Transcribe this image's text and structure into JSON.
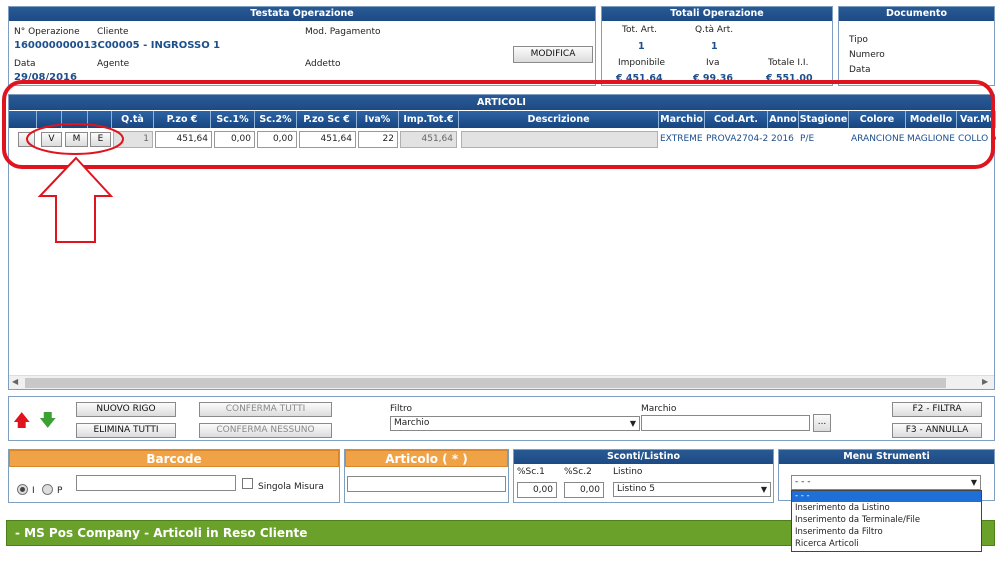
{
  "testata": {
    "title": "Testata Operazione",
    "n_operazione_label": "N° Operazione",
    "cliente_label": "Cliente",
    "mod_pagamento_label": "Mod. Pagamento",
    "operazione_cliente_value": "160000000013C00005 - INGROSSO 1",
    "data_label": "Data",
    "agente_label": "Agente",
    "addetto_label": "Addetto",
    "data_value": "29/08/2016",
    "modifica_button": "MODIFICA"
  },
  "totali": {
    "title": "Totali Operazione",
    "tot_art_label": "Tot. Art.",
    "qta_art_label": "Q.tà Art.",
    "tot_art_value": "1",
    "qta_art_value": "1",
    "imponibile_label": "Imponibile",
    "iva_label": "Iva",
    "totale_label": "Totale I.I.",
    "imponibile_value": "€ 451,64",
    "iva_value": "€ 99,36",
    "totale_value": "€ 551,00"
  },
  "documento": {
    "title": "Documento",
    "tipo_label": "Tipo",
    "numero_label": "Numero",
    "data_label": "Data"
  },
  "articoli": {
    "title": "ARTICOLI",
    "columns": [
      "Q.tà",
      "P.zo €",
      "Sc.1%",
      "Sc.2%",
      "P.zo Sc €",
      "Iva%",
      "Imp.Tot.€",
      "Descrizione",
      "Marchio",
      "Cod.Art.",
      "Anno",
      "Stagione",
      "Colore",
      "Modello",
      "Var.Mo"
    ],
    "row_buttons": {
      "v": "V",
      "m": "M",
      "e": "E"
    },
    "row": {
      "qta": "1",
      "prezzo": "451,64",
      "sc1": "0,00",
      "sc2": "0,00",
      "prezzo_sc": "451,64",
      "iva": "22",
      "imp_tot": "451,64",
      "descrizione": "",
      "marchio": "EXTREME",
      "cod_art": "PROVA2704-2",
      "anno": "2016",
      "stagione": "P/E",
      "colore": "ARANCIONE",
      "modello": "MAGLIONE",
      "var_mo": "COLLO A"
    }
  },
  "toolbar": {
    "nuovo_rigo": "NUOVO RIGO",
    "elimina_tutti": "ELIMINA TUTTI",
    "conferma_tutti": "CONFERMA TUTTI",
    "conferma_nessuno": "CONFERMA NESSUNO",
    "filtro_label": "Filtro",
    "filtro_value": "Marchio",
    "marchio_label": "Marchio",
    "marchio_value": "",
    "browse_button": "...",
    "f2_button": "F2 - FILTRA",
    "f3_button": "F3 - ANNULLA"
  },
  "barcode": {
    "title": "Barcode",
    "radio_i": "I",
    "radio_p": "P",
    "singola_misura": "Singola Misura",
    "value": ""
  },
  "articolo": {
    "title": "Articolo ( * )",
    "value": ""
  },
  "sconti": {
    "title": "Sconti/Listino",
    "sc1_label": "%Sc.1",
    "sc2_label": "%Sc.2",
    "listino_label": "Listino",
    "sc1_value": "0,00",
    "sc2_value": "0,00",
    "listino_value": "Listino 5"
  },
  "menu_strumenti": {
    "title": "Menu Strumenti",
    "selected": "- - -",
    "options": [
      "- - -",
      "Inserimento da Listino",
      "Inserimento da Terminale/File",
      "Inserimento da Filtro",
      "Ricerca Articoli"
    ]
  },
  "footer": {
    "title": "- MS Pos Company - Articoli in Reso Cliente"
  },
  "colors": {
    "header_blue": "#1c4a84",
    "value_blue": "#1c4f8c",
    "annotation_red": "#e0141e",
    "orange": "#f0a346",
    "footer_green": "#6aa12a"
  }
}
